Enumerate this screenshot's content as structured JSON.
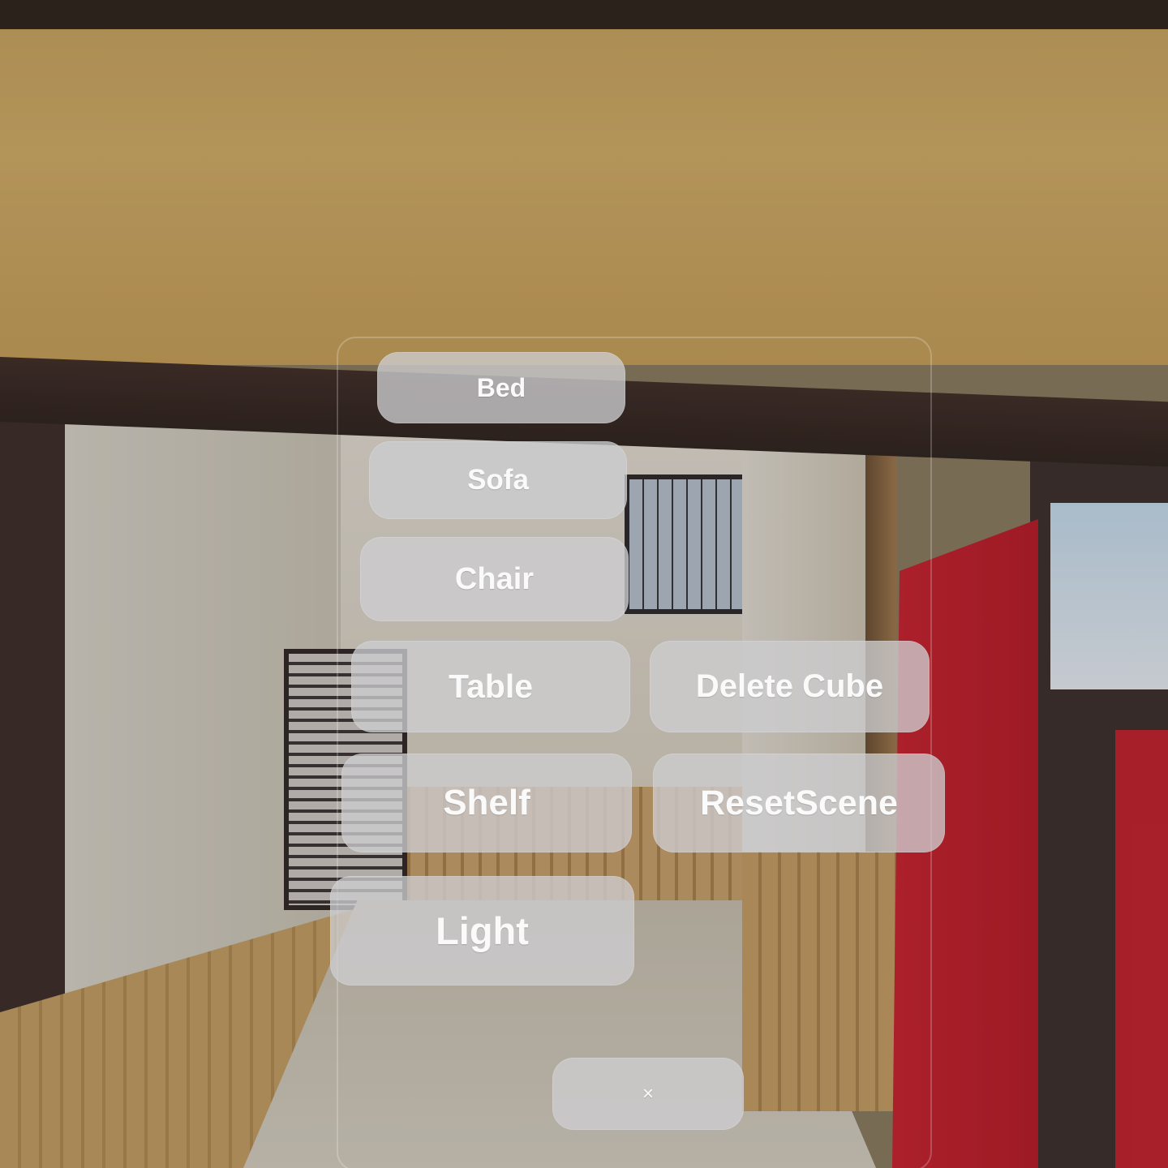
{
  "menu": {
    "bed_label": "Bed",
    "sofa_label": "Sofa",
    "chair_label": "Chair",
    "table_label": "Table",
    "delete_cube_label": "Delete Cube",
    "shelf_label": "Shelf",
    "reset_scene_label": "ResetScene",
    "light_label": "Light",
    "close_label": "×"
  }
}
